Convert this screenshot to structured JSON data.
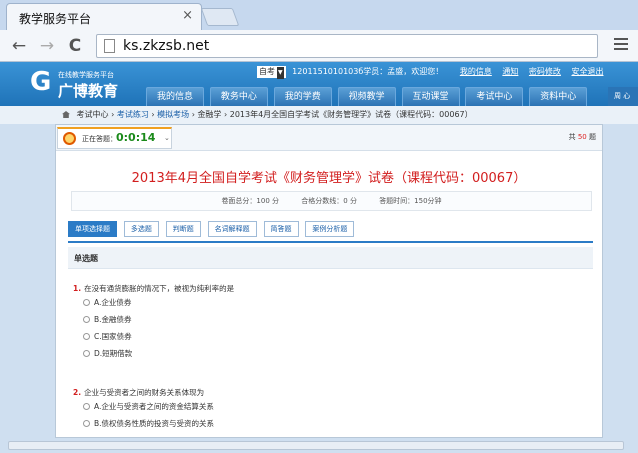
{
  "browser": {
    "tab_title": "教学服务平台",
    "tab_close": "×",
    "back": "←",
    "forward": "→",
    "reload": "C",
    "url": "ks.zkzsb.net"
  },
  "site": {
    "logo_glyph": "G",
    "logo_sub": "在线教学服务平台",
    "logo_main": "广博教育",
    "mode_select": "自考",
    "user_text": "1201151010103б学员：孟盛，欢迎您！",
    "top_links": [
      "我的信息",
      "通知",
      "密码修改",
      "安全退出"
    ],
    "nav_tabs": [
      "我的信息",
      "教务中心",
      "我的学费",
      "视频教学",
      "互动课堂",
      "考试中心",
      "资料中心"
    ],
    "side_tab": "周 心"
  },
  "breadcrumb": {
    "items": [
      "考试中心",
      "考试练习",
      "模拟考场",
      "金融学",
      "2013年4月全国自学考试《财务管理学》试卷（课程代码：00067）"
    ],
    "separator": "›"
  },
  "timer": {
    "label": "正在答题：",
    "value": "0:0:14",
    "arrow": "⌄"
  },
  "total": {
    "prefix": "共",
    "count": "50",
    "suffix": "题"
  },
  "exam": {
    "title": "2013年4月全国自学考试《财务管理学》试卷（课程代码：00067）",
    "total_score": "卷面总分：100 分",
    "pass_score": "合格分数线：0 分",
    "time_limit": "答题时间：150分钟"
  },
  "question_types": [
    "单项选择题",
    "多选题",
    "判断题",
    "名词解释题",
    "简答题",
    "案例分析题"
  ],
  "section_title": "单选题",
  "questions": [
    {
      "num": "1.",
      "text": "在没有通货膨胀的情况下，被视为纯利率的是",
      "options": [
        "A.企业债券",
        "B.金融债券",
        "C.国家债券",
        "D.短期借款"
      ]
    },
    {
      "num": "2.",
      "text": "企业与受资者之间的财务关系体现为",
      "options": [
        "A.企业与受资者之间的资金结算关系",
        "B.债权债务性质的投资与受资的关系"
      ]
    }
  ]
}
